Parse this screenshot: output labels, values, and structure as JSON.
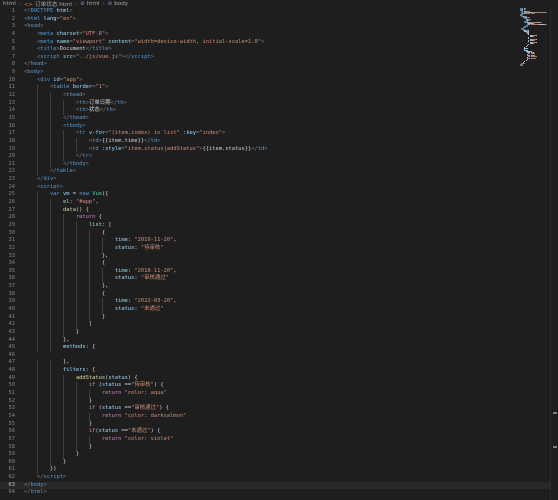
{
  "breadcrumb": {
    "items": [
      {
        "icon": "html-file-icon",
        "label": "html"
      },
      {
        "icon": "html-file-icon",
        "label": "订单状态.html"
      },
      {
        "icon": "element-icon",
        "label": "html"
      },
      {
        "icon": "element-icon",
        "label": "body"
      }
    ]
  },
  "editor": {
    "current_line": 63,
    "lines": [
      [
        [
          "p",
          "<!"
        ],
        [
          "t",
          "DOCTYPE"
        ],
        [
          "p",
          " "
        ],
        [
          "a",
          "html"
        ],
        [
          "p",
          ">"
        ]
      ],
      [
        [
          "p",
          "<"
        ],
        [
          "t",
          "html"
        ],
        [
          "p",
          " "
        ],
        [
          "a",
          "lang"
        ],
        [
          "p",
          "="
        ],
        [
          "s",
          "\"en\""
        ],
        [
          "p",
          ">"
        ]
      ],
      [
        [
          "p",
          "<"
        ],
        [
          "t",
          "head"
        ],
        [
          "p",
          ">"
        ]
      ],
      [
        [
          "p",
          "    <"
        ],
        [
          "t",
          "meta"
        ],
        [
          "p",
          " "
        ],
        [
          "a",
          "charset"
        ],
        [
          "p",
          "="
        ],
        [
          "s",
          "\"UTF-8\""
        ],
        [
          "p",
          ">"
        ]
      ],
      [
        [
          "p",
          "    <"
        ],
        [
          "t",
          "meta"
        ],
        [
          "p",
          " "
        ],
        [
          "a",
          "name"
        ],
        [
          "p",
          "="
        ],
        [
          "s",
          "\"viewport\""
        ],
        [
          "p",
          " "
        ],
        [
          "a",
          "content"
        ],
        [
          "p",
          "="
        ],
        [
          "s",
          "\"width=device-width, initial-scale=1.0\""
        ],
        [
          "p",
          ">"
        ]
      ],
      [
        [
          "p",
          "    <"
        ],
        [
          "t",
          "title"
        ],
        [
          "p",
          ">"
        ],
        [
          "x",
          "Document"
        ],
        [
          "p",
          "</"
        ],
        [
          "t",
          "title"
        ],
        [
          "p",
          ">"
        ]
      ],
      [
        [
          "p",
          "    <"
        ],
        [
          "t",
          "script"
        ],
        [
          "p",
          " "
        ],
        [
          "a",
          "src"
        ],
        [
          "p",
          "="
        ],
        [
          "s",
          "\"../js/vue.js\""
        ],
        [
          "p",
          "></"
        ],
        [
          "t",
          "script"
        ],
        [
          "p",
          ">"
        ]
      ],
      [
        [
          "p",
          "</"
        ],
        [
          "t",
          "head"
        ],
        [
          "p",
          ">"
        ]
      ],
      [
        [
          "p",
          "<"
        ],
        [
          "t",
          "body"
        ],
        [
          "p",
          ">"
        ]
      ],
      [
        [
          "p",
          "    <"
        ],
        [
          "t",
          "div"
        ],
        [
          "p",
          " "
        ],
        [
          "a",
          "id"
        ],
        [
          "p",
          "="
        ],
        [
          "s",
          "\"app\""
        ],
        [
          "p",
          ">"
        ]
      ],
      [
        [
          "p",
          "        <"
        ],
        [
          "t",
          "table"
        ],
        [
          "p",
          " "
        ],
        [
          "a",
          "border"
        ],
        [
          "p",
          "="
        ],
        [
          "s",
          "\"1\""
        ],
        [
          "p",
          ">"
        ]
      ],
      [
        [
          "p",
          "            <"
        ],
        [
          "t",
          "thead"
        ],
        [
          "p",
          ">"
        ]
      ],
      [
        [
          "p",
          "                <"
        ],
        [
          "t",
          "th"
        ],
        [
          "p",
          ">"
        ],
        [
          "x",
          "订单日期"
        ],
        [
          "p",
          "</"
        ],
        [
          "t",
          "th"
        ],
        [
          "p",
          ">"
        ]
      ],
      [
        [
          "p",
          "                <"
        ],
        [
          "t",
          "th"
        ],
        [
          "p",
          ">"
        ],
        [
          "x",
          "状态"
        ],
        [
          "p",
          "</"
        ],
        [
          "t",
          "th"
        ],
        [
          "p",
          ">"
        ]
      ],
      [
        [
          "p",
          "            </"
        ],
        [
          "t",
          "thead"
        ],
        [
          "p",
          ">"
        ]
      ],
      [
        [
          "p",
          "            <"
        ],
        [
          "t",
          "tbody"
        ],
        [
          "p",
          ">"
        ]
      ],
      [
        [
          "p",
          "                <"
        ],
        [
          "t",
          "tr"
        ],
        [
          "p",
          " "
        ],
        [
          "a",
          "v-for"
        ],
        [
          "p",
          "="
        ],
        [
          "s",
          "\"(item,index) in list\""
        ],
        [
          "p",
          " "
        ],
        [
          "a",
          ":key"
        ],
        [
          "p",
          "="
        ],
        [
          "s",
          "\"index\""
        ],
        [
          "p",
          ">"
        ]
      ],
      [
        [
          "p",
          "                    <"
        ],
        [
          "t",
          "td"
        ],
        [
          "p",
          ">"
        ],
        [
          "x",
          "{{item.time}}"
        ],
        [
          "p",
          "</"
        ],
        [
          "t",
          "td"
        ],
        [
          "p",
          ">"
        ]
      ],
      [
        [
          "p",
          "                    <"
        ],
        [
          "t",
          "td"
        ],
        [
          "p",
          " "
        ],
        [
          "a",
          ":style"
        ],
        [
          "p",
          "="
        ],
        [
          "s",
          "\"item.status|addStatus\""
        ],
        [
          "p",
          ">"
        ],
        [
          "x",
          "{{item.status}}"
        ],
        [
          "p",
          "</"
        ],
        [
          "t",
          "td"
        ],
        [
          "p",
          ">"
        ]
      ],
      [
        [
          "p",
          "                </"
        ],
        [
          "t",
          "tr"
        ],
        [
          "p",
          ">"
        ]
      ],
      [
        [
          "p",
          "            </"
        ],
        [
          "t",
          "tbody"
        ],
        [
          "p",
          ">"
        ]
      ],
      [
        [
          "p",
          "        </"
        ],
        [
          "t",
          "table"
        ],
        [
          "p",
          ">"
        ]
      ],
      [
        [
          "p",
          "    </"
        ],
        [
          "t",
          "div"
        ],
        [
          "p",
          ">"
        ]
      ],
      [
        [
          "p",
          "    <"
        ],
        [
          "t",
          "script"
        ],
        [
          "p",
          ">"
        ]
      ],
      [
        [
          "x",
          "        "
        ],
        [
          "k",
          "var"
        ],
        [
          "x",
          " "
        ],
        [
          "v",
          "vm"
        ],
        [
          "x",
          " = "
        ],
        [
          "k",
          "new"
        ],
        [
          "x",
          " "
        ],
        [
          "c",
          "Vue"
        ],
        [
          "x",
          "({"
        ]
      ],
      [
        [
          "x",
          "            "
        ],
        [
          "v",
          "el"
        ],
        [
          "x",
          ": "
        ],
        [
          "s",
          "\"#app\""
        ],
        [
          "x",
          ","
        ]
      ],
      [
        [
          "x",
          "            "
        ],
        [
          "f",
          "data"
        ],
        [
          "x",
          "() {"
        ]
      ],
      [
        [
          "x",
          "                "
        ],
        [
          "r",
          "return"
        ],
        [
          "x",
          " {"
        ]
      ],
      [
        [
          "x",
          "                    "
        ],
        [
          "v",
          "list"
        ],
        [
          "x",
          ": ["
        ]
      ],
      [
        [
          "x",
          "                        {"
        ]
      ],
      [
        [
          "x",
          "                            "
        ],
        [
          "v",
          "time"
        ],
        [
          "x",
          ": "
        ],
        [
          "s",
          "\"2019-11-20\""
        ],
        [
          "x",
          ","
        ]
      ],
      [
        [
          "x",
          "                            "
        ],
        [
          "v",
          "status"
        ],
        [
          "x",
          ": "
        ],
        [
          "s",
          "\"待审核\""
        ]
      ],
      [
        [
          "x",
          "                        },"
        ]
      ],
      [
        [
          "x",
          "                        {"
        ]
      ],
      [
        [
          "x",
          "                            "
        ],
        [
          "v",
          "time"
        ],
        [
          "x",
          ": "
        ],
        [
          "s",
          "\"2018-11-20\""
        ],
        [
          "x",
          ","
        ]
      ],
      [
        [
          "x",
          "                            "
        ],
        [
          "v",
          "status"
        ],
        [
          "x",
          ": "
        ],
        [
          "s",
          "\"审核通过\""
        ]
      ],
      [
        [
          "x",
          "                        },"
        ]
      ],
      [
        [
          "x",
          "                        {"
        ]
      ],
      [
        [
          "x",
          "                            "
        ],
        [
          "v",
          "time"
        ],
        [
          "x",
          ": "
        ],
        [
          "s",
          "\"2022-03-20\""
        ],
        [
          "x",
          ","
        ]
      ],
      [
        [
          "x",
          "                            "
        ],
        [
          "v",
          "status"
        ],
        [
          "x",
          ": "
        ],
        [
          "s",
          "\"未通过\""
        ]
      ],
      [
        [
          "x",
          "                        }"
        ]
      ],
      [
        [
          "x",
          "                    ]"
        ]
      ],
      [
        [
          "x",
          "                }"
        ]
      ],
      [
        [
          "x",
          "            },"
        ]
      ],
      [
        [
          "x",
          "            "
        ],
        [
          "v",
          "methods"
        ],
        [
          "x",
          ": {"
        ]
      ],
      [
        [
          "x",
          ""
        ]
      ],
      [
        [
          "x",
          "            },"
        ]
      ],
      [
        [
          "x",
          "            "
        ],
        [
          "v",
          "filters"
        ],
        [
          "x",
          ": {"
        ]
      ],
      [
        [
          "x",
          "                "
        ],
        [
          "f",
          "addStatus"
        ],
        [
          "x",
          "("
        ],
        [
          "v",
          "status"
        ],
        [
          "x",
          ") {"
        ]
      ],
      [
        [
          "x",
          "                    "
        ],
        [
          "r",
          "if"
        ],
        [
          "x",
          " ("
        ],
        [
          "v",
          "status"
        ],
        [
          "x",
          " =="
        ],
        [
          "s",
          "\"待审核\""
        ],
        [
          "x",
          ") {"
        ]
      ],
      [
        [
          "x",
          "                        "
        ],
        [
          "r",
          "return"
        ],
        [
          "x",
          " "
        ],
        [
          "s",
          "\"color: aqua\""
        ]
      ],
      [
        [
          "x",
          "                    }"
        ]
      ],
      [
        [
          "x",
          "                    "
        ],
        [
          "r",
          "if"
        ],
        [
          "x",
          " ("
        ],
        [
          "v",
          "status"
        ],
        [
          "x",
          " =="
        ],
        [
          "s",
          "\"审核通过\""
        ],
        [
          "x",
          ") {"
        ]
      ],
      [
        [
          "x",
          "                        "
        ],
        [
          "r",
          "return"
        ],
        [
          "x",
          " "
        ],
        [
          "s",
          "\"color: darksalmon\""
        ]
      ],
      [
        [
          "x",
          "                    }"
        ]
      ],
      [
        [
          "x",
          "                    "
        ],
        [
          "r",
          "if"
        ],
        [
          "x",
          "("
        ],
        [
          "v",
          "status"
        ],
        [
          "x",
          " =="
        ],
        [
          "s",
          "\"未通过\""
        ],
        [
          "x",
          ") {"
        ]
      ],
      [
        [
          "x",
          "                        "
        ],
        [
          "r",
          "return"
        ],
        [
          "x",
          " "
        ],
        [
          "s",
          "\"color: violet\""
        ]
      ],
      [
        [
          "x",
          "                    }"
        ]
      ],
      [
        [
          "x",
          "                }"
        ]
      ],
      [
        [
          "x",
          "            }"
        ]
      ],
      [
        [
          "x",
          "        })"
        ]
      ],
      [
        [
          "p",
          "    </"
        ],
        [
          "t",
          "script"
        ],
        [
          "p",
          ">"
        ]
      ],
      [
        [
          "p",
          "</"
        ],
        [
          "t",
          "body"
        ],
        [
          "p",
          ">"
        ]
      ],
      [
        [
          "p",
          "</"
        ],
        [
          "t",
          "html"
        ],
        [
          "p",
          ">"
        ]
      ]
    ]
  },
  "colors": {
    "p": "#808080",
    "t": "#569cd6",
    "a": "#9cdcfe",
    "s": "#ce9178",
    "x": "#d4d4d4",
    "k": "#569cd6",
    "v": "#9cdcfe",
    "c": "#4ec9b0",
    "f": "#dcdcaa",
    "r": "#c586c0"
  }
}
